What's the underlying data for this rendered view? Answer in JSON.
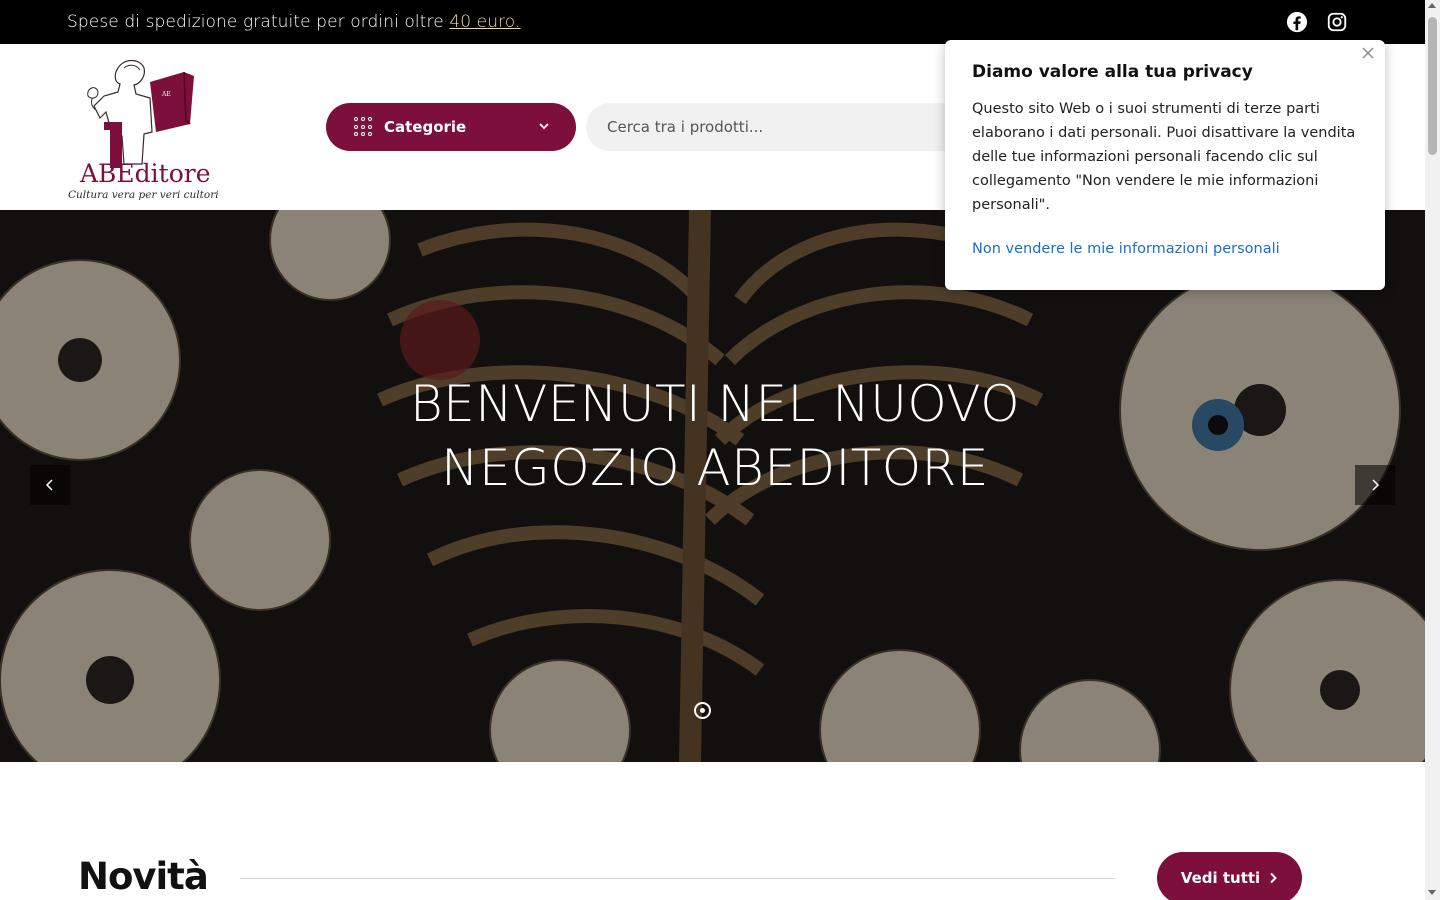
{
  "topbar": {
    "promo_text": "Spese di spedizione gratuite per ordini oltre ",
    "promo_link": "40 euro.",
    "social": [
      "facebook-icon",
      "instagram-icon"
    ]
  },
  "header": {
    "logo_title": "ABEditore",
    "logo_tagline": "Cultura vera per veri cultori",
    "categories_label": "Categorie",
    "search_placeholder": "Cerca tra i prodotti..."
  },
  "hero": {
    "title_line1": "BENVENUTI NEL NUOVO",
    "title_line2": "NEGOZIO ABEDITORE"
  },
  "section": {
    "title": "Novità",
    "see_all_label": "Vedi tutti"
  },
  "privacy": {
    "title": "Diamo valore alla tua privacy",
    "body": "Questo sito Web o i suoi strumenti di terze parti elaborano i dati personali. Puoi disattivare la vendita delle tue informazioni personali facendo clic sul collegamento \"Non vendere le mie informazioni personali\".",
    "link_label": "Non vendere le mie informazioni personali"
  },
  "colors": {
    "brand": "#7d0f3c",
    "link": "#1a6fcb",
    "promo_link": "#f3d99a"
  }
}
